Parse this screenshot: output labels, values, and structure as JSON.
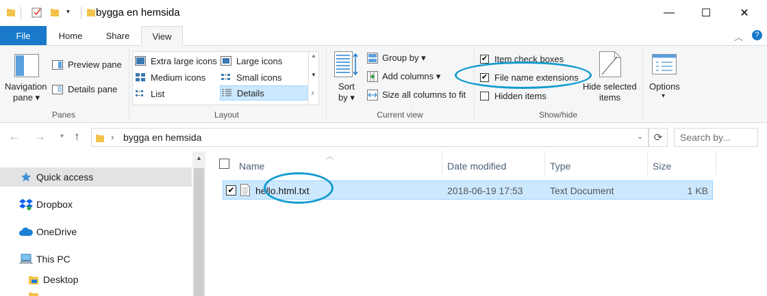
{
  "window": {
    "title": "bygga en hemsida",
    "minimize": "—",
    "maximize": "☐",
    "close": "✕"
  },
  "tabs": [
    {
      "label": "File"
    },
    {
      "label": "Home"
    },
    {
      "label": "Share"
    },
    {
      "label": "View"
    }
  ],
  "ribbon": {
    "panes": {
      "navigation_pane_line1": "Navigation",
      "navigation_pane_line2": "pane",
      "preview_pane": "Preview pane",
      "details_pane": "Details pane",
      "label": "Panes"
    },
    "layout": {
      "items": [
        "Extra large icons",
        "Large icons",
        "Medium icons",
        "Small icons",
        "List",
        "Details"
      ],
      "label": "Layout"
    },
    "current_view": {
      "sort_line1": "Sort",
      "sort_line2": "by",
      "group_by": "Group by",
      "add_columns": "Add columns",
      "size_all_columns": "Size all columns to fit",
      "label": "Current view"
    },
    "show_hide": {
      "item_check_boxes": "Item check boxes",
      "item_check_boxes_checked": true,
      "file_name_extensions": "File name extensions",
      "file_name_extensions_checked": true,
      "hidden_items": "Hidden items",
      "hidden_items_checked": false,
      "hide_selected_line1": "Hide selected",
      "hide_selected_line2": "items",
      "label": "Show/hide"
    },
    "options": {
      "label": "Options"
    }
  },
  "address": {
    "path": "bygga en hemsida",
    "search_placeholder": "Search by..."
  },
  "nav_pane": {
    "items": [
      {
        "label": "Quick access",
        "icon": "star-icon"
      },
      {
        "label": "Dropbox",
        "icon": "dropbox-icon"
      },
      {
        "label": "OneDrive",
        "icon": "cloud-icon"
      },
      {
        "label": "This PC",
        "icon": "computer-icon"
      },
      {
        "label": "Desktop",
        "icon": "folder-icon"
      }
    ]
  },
  "file_list": {
    "columns": [
      "Name",
      "Date modified",
      "Type",
      "Size"
    ],
    "rows": [
      {
        "name": "hello.html.txt",
        "date": "2018-06-19 17:53",
        "type": "Text Document",
        "size": "1 KB",
        "checked": true
      }
    ]
  },
  "colors": {
    "accent": "#1979ca",
    "selection": "#cce8ff",
    "annotation": "#139bcf"
  }
}
